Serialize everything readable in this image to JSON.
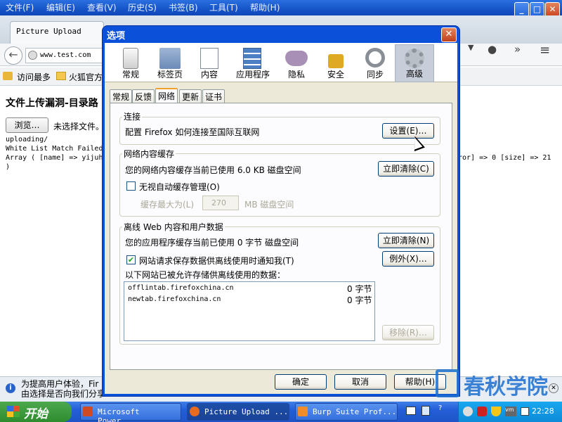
{
  "browser": {
    "menu": [
      "文件(F)",
      "编辑(E)",
      "查看(V)",
      "历史(S)",
      "书签(B)",
      "工具(T)",
      "帮助(H)"
    ],
    "tab_title": "Picture Upload",
    "url": "www.test.com",
    "bookmarks": [
      "访问最多",
      "火狐官方"
    ],
    "page": {
      "title": "文件上传漏洞-目录路",
      "browse_label": "浏览…",
      "no_file": "未选择文件。",
      "line1": "uploading/",
      "line2": "White List Match Failed",
      "line3": "Array ( [name] => yijuh",
      "line3_right": "ror] => 0 [size] => 21",
      "line4": ")"
    },
    "notification": {
      "line1": "为提高用户体验，Fir",
      "line2": "由选择是否向我们分享"
    }
  },
  "dialog": {
    "title": "选项",
    "panes": [
      {
        "label": "常规",
        "icon": "switch-icon"
      },
      {
        "label": "标签页",
        "icon": "folder-tabs-icon"
      },
      {
        "label": "内容",
        "icon": "content-page-icon"
      },
      {
        "label": "应用程序",
        "icon": "applications-icon"
      },
      {
        "label": "隐私",
        "icon": "mask-icon"
      },
      {
        "label": "安全",
        "icon": "padlock-icon"
      },
      {
        "label": "同步",
        "icon": "sync-icon"
      },
      {
        "label": "高级",
        "icon": "gear-icon"
      }
    ],
    "selected_pane": "高级",
    "subtabs": [
      "常规",
      "反馈",
      "网络",
      "更新",
      "证书"
    ],
    "selected_subtab": "网络",
    "connection": {
      "legend": "连接",
      "description": "配置 Firefox 如何连接至国际互联网",
      "settings_button": "设置(E)…"
    },
    "cache": {
      "legend": "网络内容缓存",
      "usage": "您的网络内容缓存当前已使用 6.0 KB 磁盘空间",
      "clear_button": "立即清除(C)",
      "override_label": "无视自动缓存管理(O)",
      "override_checked": false,
      "limit_label": "缓存最大为(L)",
      "limit_value": "270",
      "limit_unit": "MB 磁盘空间"
    },
    "offline": {
      "legend": "离线 Web 内容和用户数据",
      "usage": "您的应用程序缓存当前已使用 0 字节 磁盘空间",
      "clear_button": "立即清除(N)",
      "notify_label": "网站请求保存数据供离线使用时通知我(T)",
      "notify_checked": true,
      "exceptions_button": "例外(X)…",
      "allowed_label": "以下网站已被允许存储供离线使用的数据：",
      "sites": [
        {
          "site": "offlintab.firefoxchina.cn",
          "size": "0 字节"
        },
        {
          "site": "newtab.firefoxchina.cn",
          "size": "0 字节"
        }
      ],
      "remove_button": "移除(R)…"
    },
    "ok_button": "确定",
    "cancel_button": "取消",
    "help_button": "帮助(H)"
  },
  "taskbar": {
    "start_label": "开始",
    "tasks": [
      "Microsoft Power...",
      "Picture Upload ...",
      "Burp Suite Prof..."
    ],
    "clock": "22:28"
  },
  "watermark": "春秋学院"
}
